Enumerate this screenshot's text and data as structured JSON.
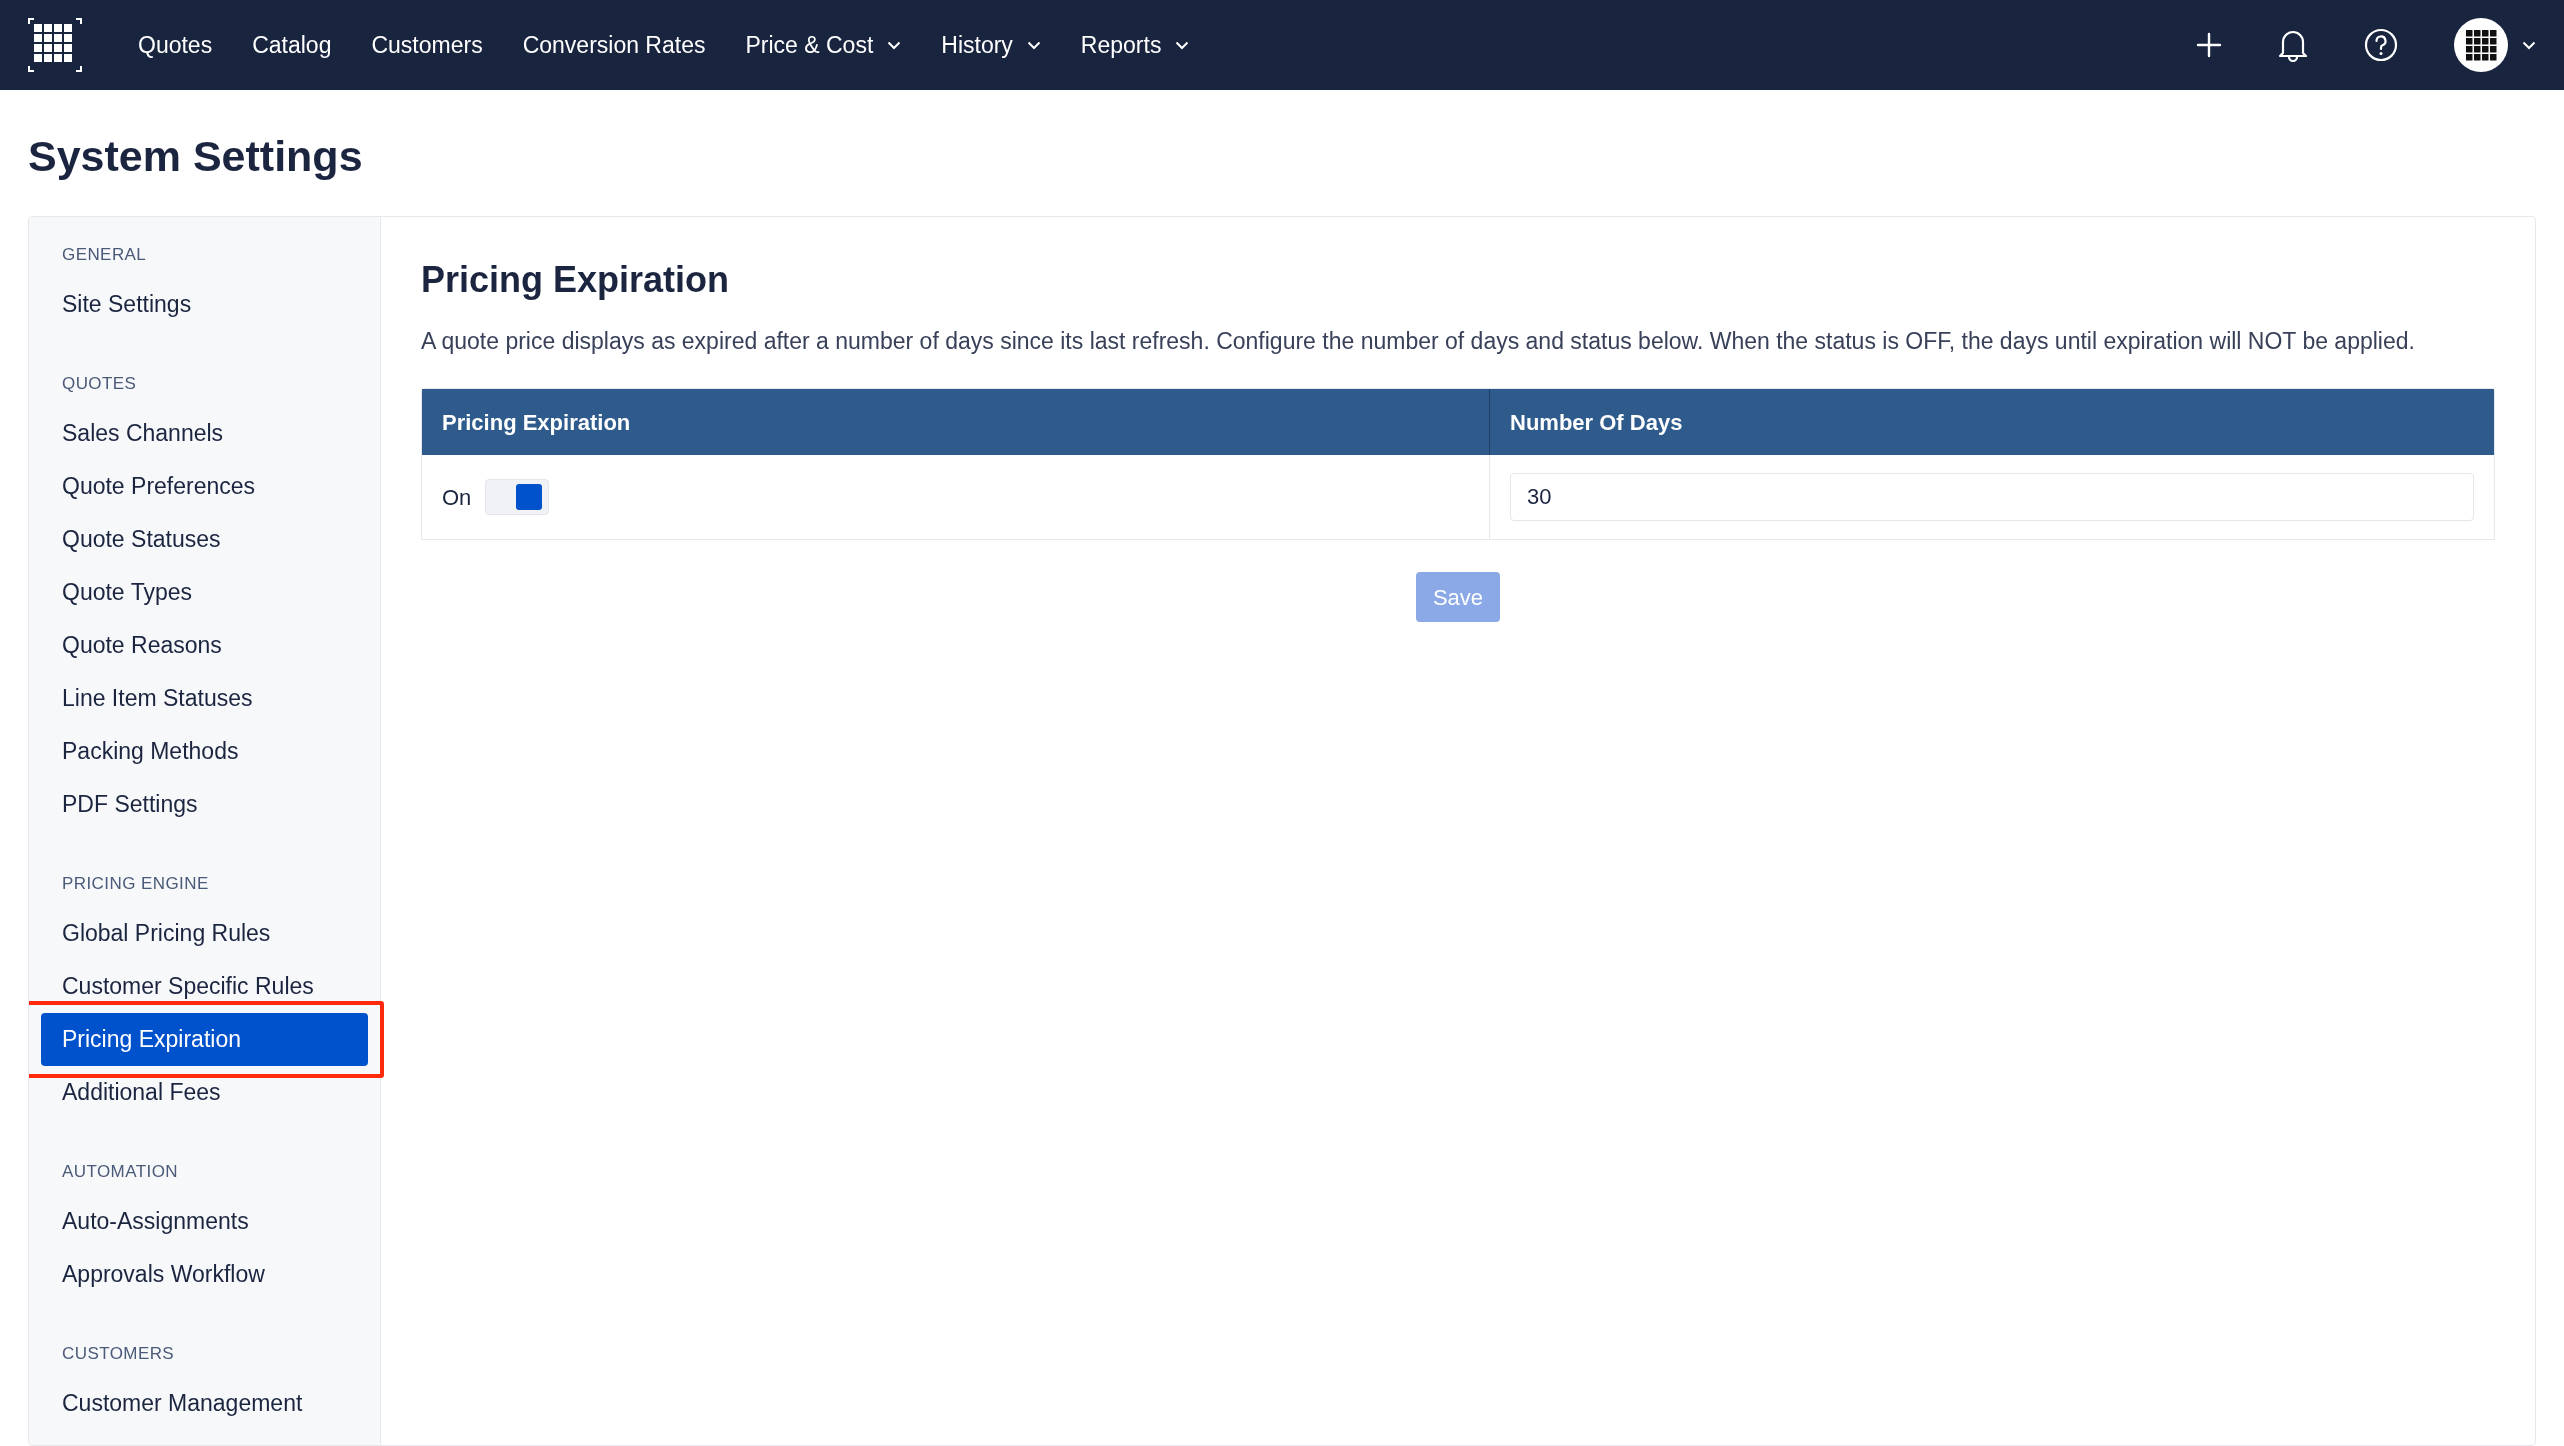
{
  "nav": {
    "items": [
      {
        "label": "Quotes",
        "dropdown": false
      },
      {
        "label": "Catalog",
        "dropdown": false
      },
      {
        "label": "Customers",
        "dropdown": false
      },
      {
        "label": "Conversion Rates",
        "dropdown": false
      },
      {
        "label": "Price & Cost",
        "dropdown": true
      },
      {
        "label": "History",
        "dropdown": true
      },
      {
        "label": "Reports",
        "dropdown": true
      }
    ]
  },
  "page_title": "System Settings",
  "sidebar": {
    "groups": [
      {
        "label": "GENERAL",
        "items": [
          {
            "label": "Site Settings",
            "selected": false,
            "highlighted": false
          }
        ]
      },
      {
        "label": "QUOTES",
        "items": [
          {
            "label": "Sales Channels",
            "selected": false,
            "highlighted": false
          },
          {
            "label": "Quote Preferences",
            "selected": false,
            "highlighted": false
          },
          {
            "label": "Quote Statuses",
            "selected": false,
            "highlighted": false
          },
          {
            "label": "Quote Types",
            "selected": false,
            "highlighted": false
          },
          {
            "label": "Quote Reasons",
            "selected": false,
            "highlighted": false
          },
          {
            "label": "Line Item Statuses",
            "selected": false,
            "highlighted": false
          },
          {
            "label": "Packing Methods",
            "selected": false,
            "highlighted": false
          },
          {
            "label": "PDF Settings",
            "selected": false,
            "highlighted": false
          }
        ]
      },
      {
        "label": "PRICING ENGINE",
        "items": [
          {
            "label": "Global Pricing Rules",
            "selected": false,
            "highlighted": false
          },
          {
            "label": "Customer Specific Rules",
            "selected": false,
            "highlighted": false
          },
          {
            "label": "Pricing Expiration",
            "selected": true,
            "highlighted": true
          },
          {
            "label": "Additional Fees",
            "selected": false,
            "highlighted": false
          }
        ]
      },
      {
        "label": "AUTOMATION",
        "items": [
          {
            "label": "Auto-Assignments",
            "selected": false,
            "highlighted": false
          },
          {
            "label": "Approvals Workflow",
            "selected": false,
            "highlighted": false
          }
        ]
      },
      {
        "label": "CUSTOMERS",
        "items": [
          {
            "label": "Customer Management",
            "selected": false,
            "highlighted": false
          }
        ]
      }
    ]
  },
  "content": {
    "title": "Pricing Expiration",
    "description": "A quote price displays as expired after a number of days since its last refresh. Configure the number of days and status below. When the status is OFF, the days until expiration will NOT be applied.",
    "table": {
      "columns": [
        "Pricing Expiration",
        "Number Of Days"
      ],
      "rows": [
        {
          "status_label": "On",
          "on": true,
          "days": "30"
        }
      ]
    },
    "save_button": {
      "label": "Save",
      "disabled": true
    }
  }
}
